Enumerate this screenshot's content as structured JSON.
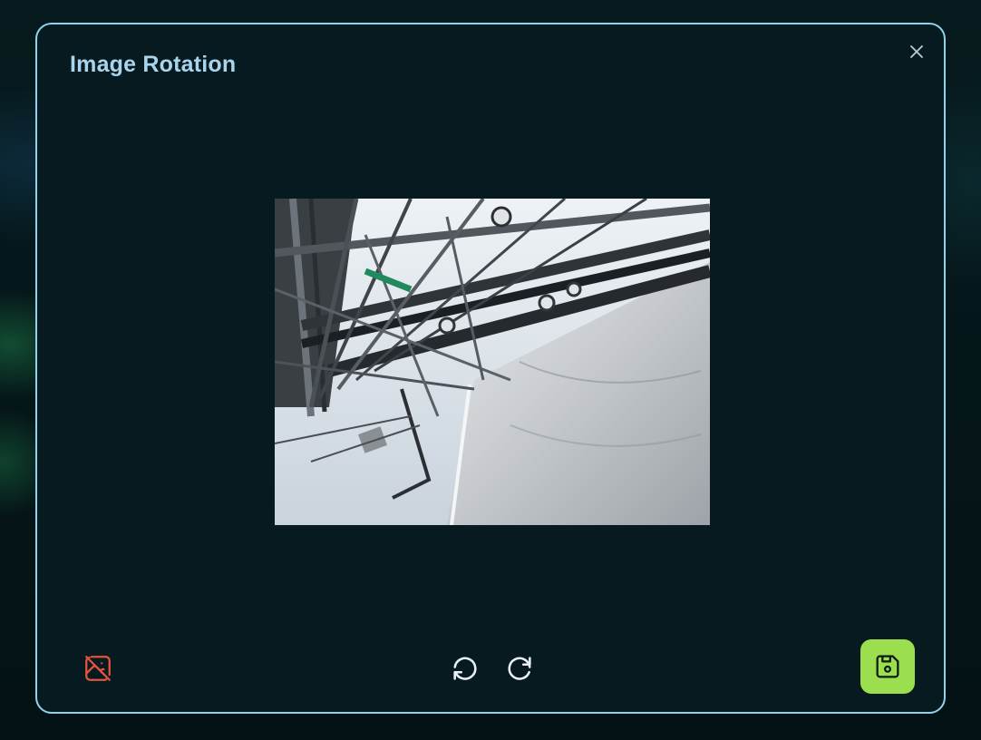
{
  "dialog": {
    "title": "Image Rotation"
  },
  "icons": {
    "close": "close-icon",
    "remove_image": "image-off-icon",
    "rotate_left": "rotate-counterclockwise-icon",
    "rotate_right": "rotate-clockwise-icon",
    "save": "save-floppy-icon"
  },
  "colors": {
    "modal_border": "#8fd3ec",
    "title": "#a9d5ec",
    "remove_icon": "#e5533d",
    "save_button": "#9bdf4f",
    "background": "#051416"
  }
}
